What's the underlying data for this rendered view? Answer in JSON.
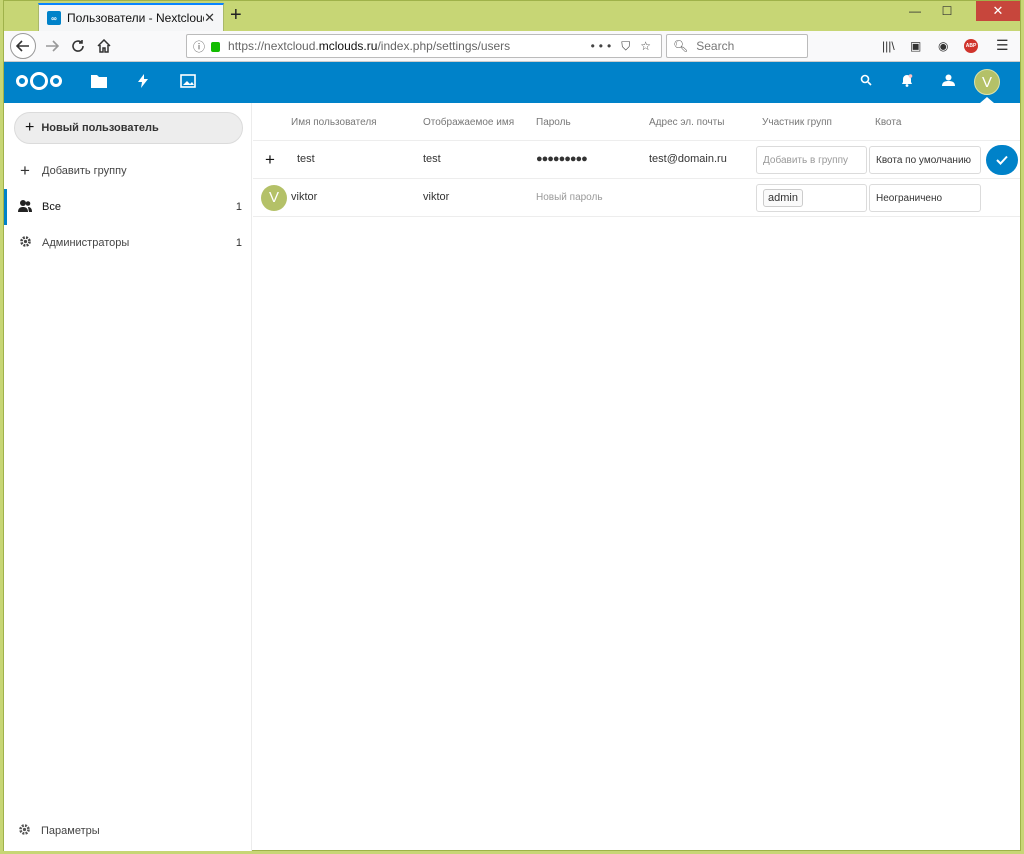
{
  "browser": {
    "tab_title": "Пользователи - Nextcloud",
    "tab_close": "✕",
    "new_tab": "+",
    "url_prefix": "https://nextcloud.",
    "url_domain": "mclouds.ru",
    "url_path": "/index.php/settings/users",
    "search_placeholder": "Search",
    "win_min": "—",
    "win_max": "☐",
    "win_close": "✕",
    "abp": "ABP"
  },
  "nextcloud": {
    "brand_color": "#0082c9",
    "user_initial": "V"
  },
  "sidebar": {
    "new_user_label": "Новый пользователь",
    "add_group_label": "Добавить группу",
    "groups": [
      {
        "label": "Все",
        "count": "1"
      },
      {
        "label": "Администраторы",
        "count": "1"
      }
    ],
    "settings_label": "Параметры"
  },
  "table": {
    "headers": {
      "username": "Имя пользователя",
      "display_name": "Отображаемое имя",
      "password": "Пароль",
      "email": "Адрес эл. почты",
      "groups": "Участник групп",
      "quota": "Квота"
    },
    "new_row": {
      "username": "test",
      "display_name": "test",
      "password": "●●●●●●●●●",
      "email": "test@domain.ru",
      "groups_placeholder": "Добавить в группу",
      "quota": "Квота по умолчанию"
    },
    "rows": [
      {
        "initial": "V",
        "username": "viktor",
        "display_name": "viktor",
        "password_placeholder": "Новый пароль",
        "group": "admin",
        "quota": "Неограничено"
      }
    ]
  }
}
